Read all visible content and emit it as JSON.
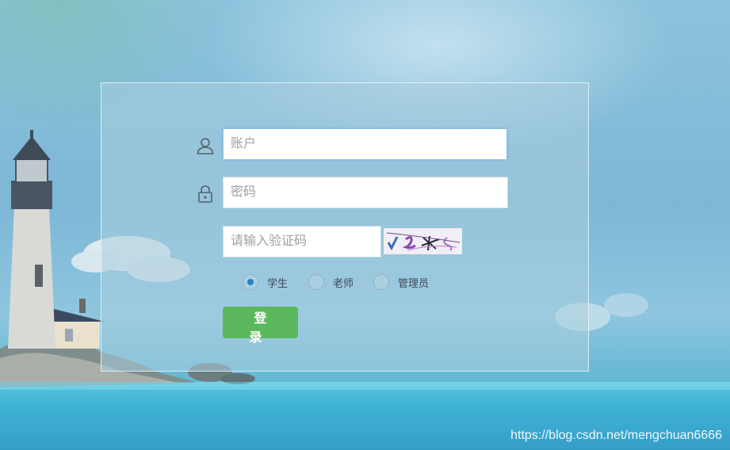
{
  "login_form": {
    "account_placeholder": "账户",
    "password_placeholder": "密码",
    "captcha_placeholder": "请输入验证码",
    "roles": [
      {
        "label": "学生",
        "checked": true
      },
      {
        "label": "老师",
        "checked": false
      },
      {
        "label": "管理员",
        "checked": false
      }
    ],
    "login_label": "登 录",
    "login_color": "#5cb85c"
  },
  "icons": {
    "account": "user-icon",
    "password": "lock-icon",
    "captcha": "captcha-image"
  },
  "watermark": "https://blog.csdn.net/mengchuan6666"
}
